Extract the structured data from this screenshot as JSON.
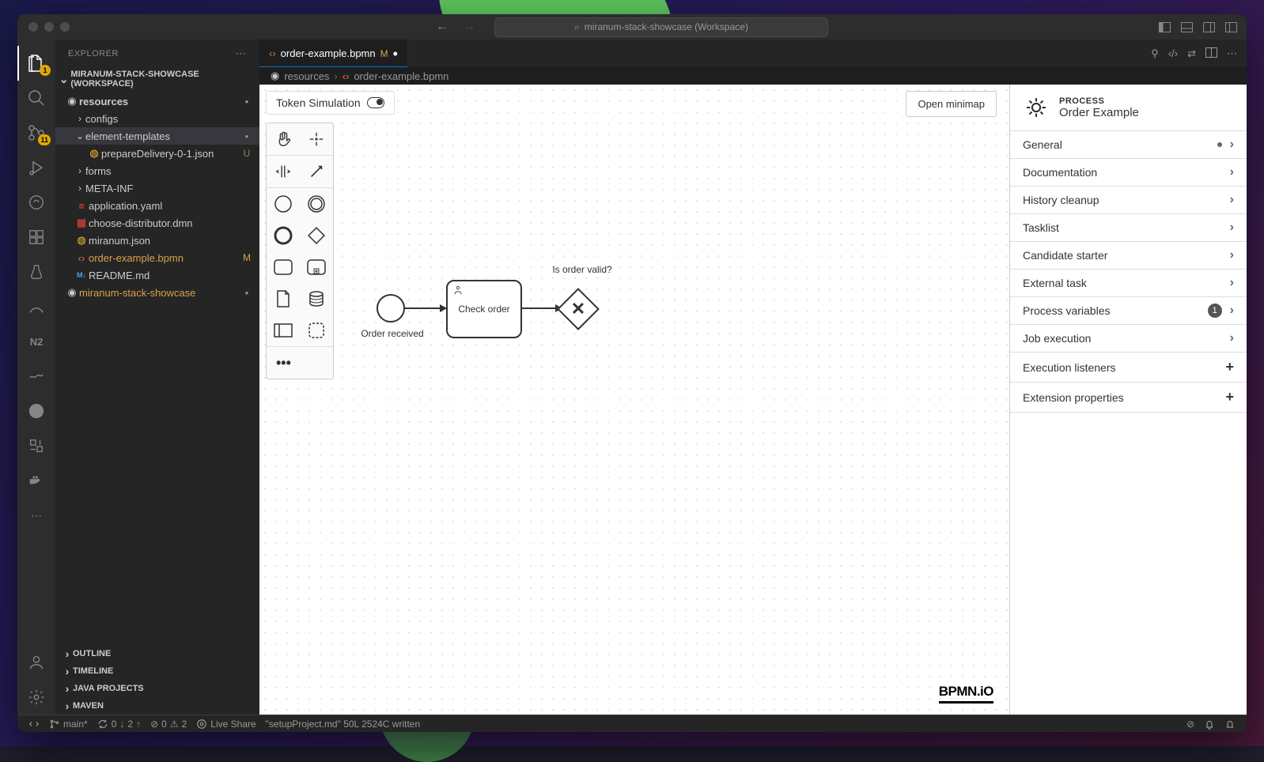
{
  "titlebar": {
    "title": "miranum-stack-showcase (Workspace)"
  },
  "sidebar": {
    "title": "EXPLORER",
    "workspace": "MIRANUM-STACK-SHOWCASE (WORKSPACE)",
    "tree": {
      "resources": "resources",
      "configs": "configs",
      "element_templates": "element-templates",
      "prepare_delivery": "prepareDelivery-0-1.json",
      "forms": "forms",
      "meta_inf": "META-INF",
      "application_yaml": "application.yaml",
      "choose_distributor": "choose-distributor.dmn",
      "miranum_json": "miranum.json",
      "order_example": "order-example.bpmn",
      "readme": "README.md",
      "miranum_showcase": "miranum-stack-showcase"
    },
    "status": {
      "m": "M",
      "u": "U"
    },
    "bottom": {
      "outline": "OUTLINE",
      "timeline": "TIMELINE",
      "java_projects": "JAVA PROJECTS",
      "maven": "MAVEN"
    }
  },
  "tab": {
    "filename": "order-example.bpmn",
    "status": "M"
  },
  "breadcrumb": {
    "folder": "resources",
    "file": "order-example.bpmn"
  },
  "canvas": {
    "token_simulation": "Token Simulation",
    "open_minimap": "Open minimap",
    "bpmn_logo": "BPMN.iO",
    "start_label": "Order received",
    "task_label": "Check order",
    "gateway_label": "Is order valid?"
  },
  "props": {
    "header_label": "PROCESS",
    "header_name": "Order Example",
    "groups": {
      "general": "General",
      "documentation": "Documentation",
      "history_cleanup": "History cleanup",
      "tasklist": "Tasklist",
      "candidate_starter": "Candidate starter",
      "external_task": "External task",
      "process_variables": "Process variables",
      "process_variables_count": "1",
      "job_execution": "Job execution",
      "execution_listeners": "Execution listeners",
      "extension_properties": "Extension properties"
    }
  },
  "statusbar": {
    "branch": "main*",
    "sync_down": "0",
    "sync_up": "2",
    "errors": "0",
    "warnings": "2",
    "live_share": "Live Share",
    "message": "\"setupProject.md\" 50L 2524C written"
  },
  "activity": {
    "explorer_badge": "1",
    "scm_badge": "11"
  }
}
